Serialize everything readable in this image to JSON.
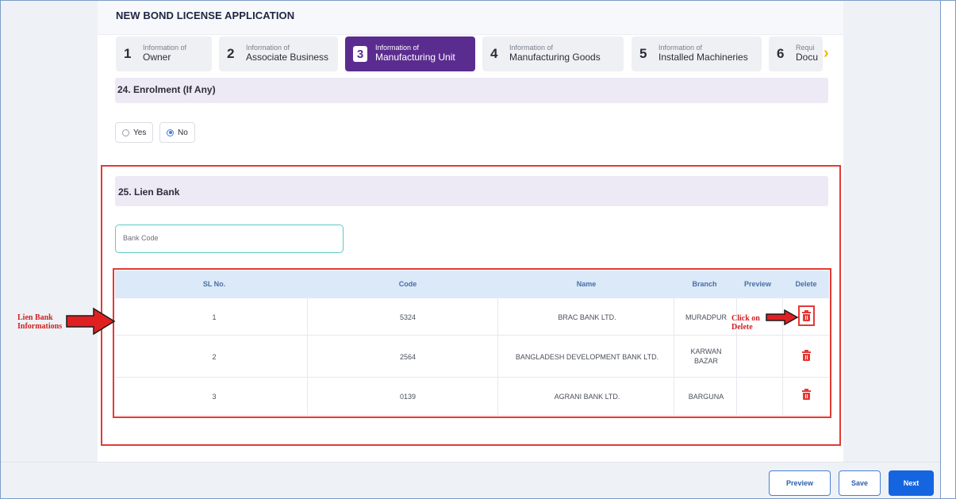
{
  "header": {
    "title": "NEW BOND LICENSE APPLICATION"
  },
  "steps": [
    {
      "num": "1",
      "small": "Information of",
      "big": "Owner"
    },
    {
      "num": "2",
      "small": "Information of",
      "big": "Associate Business"
    },
    {
      "num": "3",
      "small": "Information of",
      "big": "Manufacturing Unit"
    },
    {
      "num": "4",
      "small": "Information of",
      "big": "Manufacturing Goods"
    },
    {
      "num": "5",
      "small": "Information of",
      "big": "Installed Machineries"
    },
    {
      "num": "6",
      "small": "Requi",
      "big": "Docu"
    }
  ],
  "enrolment": {
    "label": "24. Enrolment (If Any)",
    "options": [
      "Yes",
      "No"
    ],
    "selected": "No"
  },
  "lien": {
    "label": "25. Lien Bank",
    "input_placeholder": "Bank Code",
    "columns": [
      "SL No.",
      "Code",
      "Name",
      "Branch",
      "Preview",
      "Delete"
    ],
    "rows": [
      {
        "sl": "1",
        "code": "5324",
        "name": "BRAC BANK LTD.",
        "branch": "MURADPUR"
      },
      {
        "sl": "2",
        "code": "2564",
        "name": "BANGLADESH DEVELOPMENT BANK LTD.",
        "branch": "KARWAN BAZAR"
      },
      {
        "sl": "3",
        "code": "0139",
        "name": "AGRANI BANK LTD.",
        "branch": "BARGUNA"
      }
    ]
  },
  "annotations": {
    "left_line1": "Lien Bank",
    "left_line2": "Informations",
    "right_line1": "Click on",
    "right_line2": "Delete"
  },
  "footer": {
    "preview": "Preview",
    "save": "Save",
    "next": "Next"
  },
  "colors": {
    "accent": "#5b2c8f",
    "primary": "#1565e0",
    "danger": "#e53935"
  },
  "icons": {
    "next_steps": "chevron-right-icon",
    "delete": "trash-icon"
  }
}
